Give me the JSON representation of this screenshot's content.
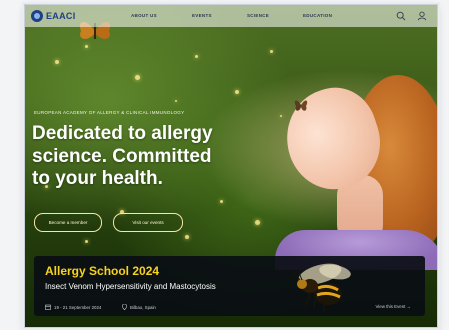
{
  "nav": {
    "logo_text": "EAACI",
    "items": [
      {
        "label": "ABOUT US"
      },
      {
        "label": "EVENTS"
      },
      {
        "label": "SCIENCE"
      },
      {
        "label": "EDUCATION"
      }
    ],
    "icons": {
      "search": "search-icon",
      "account": "user-icon"
    }
  },
  "hero": {
    "kicker": "EUROPEAN ACADEMY OF ALLERGY & CLINICAL IMMUNOLOGY",
    "headline": [
      "Dedicated to allergy",
      "science. Committed",
      "to your health."
    ],
    "buttons": {
      "member": "Become a member",
      "events": "Visit our events"
    }
  },
  "event": {
    "title": "Allergy School 2024",
    "subtitle": "Insect Venom Hypersensitivity and Mastocytosis",
    "date": "19 - 21 September 2024",
    "location": "Bilbao, Spain",
    "link": "View this Event →"
  },
  "colors": {
    "brand": "#1f3f86",
    "accent": "#f7d21e",
    "event_bg": "#0a0e14"
  }
}
